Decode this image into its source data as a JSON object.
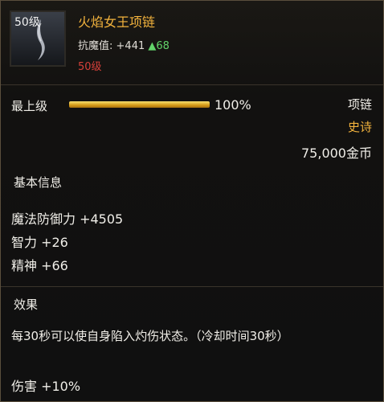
{
  "item": {
    "level_badge": "50级",
    "name": "火焰女王项链",
    "stat_label": "抗魔值:",
    "stat_value": "+441",
    "stat_up_arrow": "▲",
    "stat_up": "68",
    "requirement": "50级"
  },
  "grade": {
    "label": "最上级",
    "percent_text": "100%",
    "fill_fraction": 1.0
  },
  "meta": {
    "type": "项链",
    "rarity": "史诗",
    "price": "75,000金币"
  },
  "basic_info": {
    "title": "基本信息",
    "lines": [
      "魔法防御力 +4505",
      "智力 +26",
      "精神 +66"
    ]
  },
  "effect": {
    "title": "效果",
    "description": "每30秒可以使自身陷入灼伤状态。（冷却时间30秒）",
    "bonus": "伤害 +10%"
  },
  "colors": {
    "epic": "#f3b33d",
    "requirement": "#d6403a",
    "increase": "#63d46a"
  },
  "icons": {
    "item": "necklace-icon"
  }
}
